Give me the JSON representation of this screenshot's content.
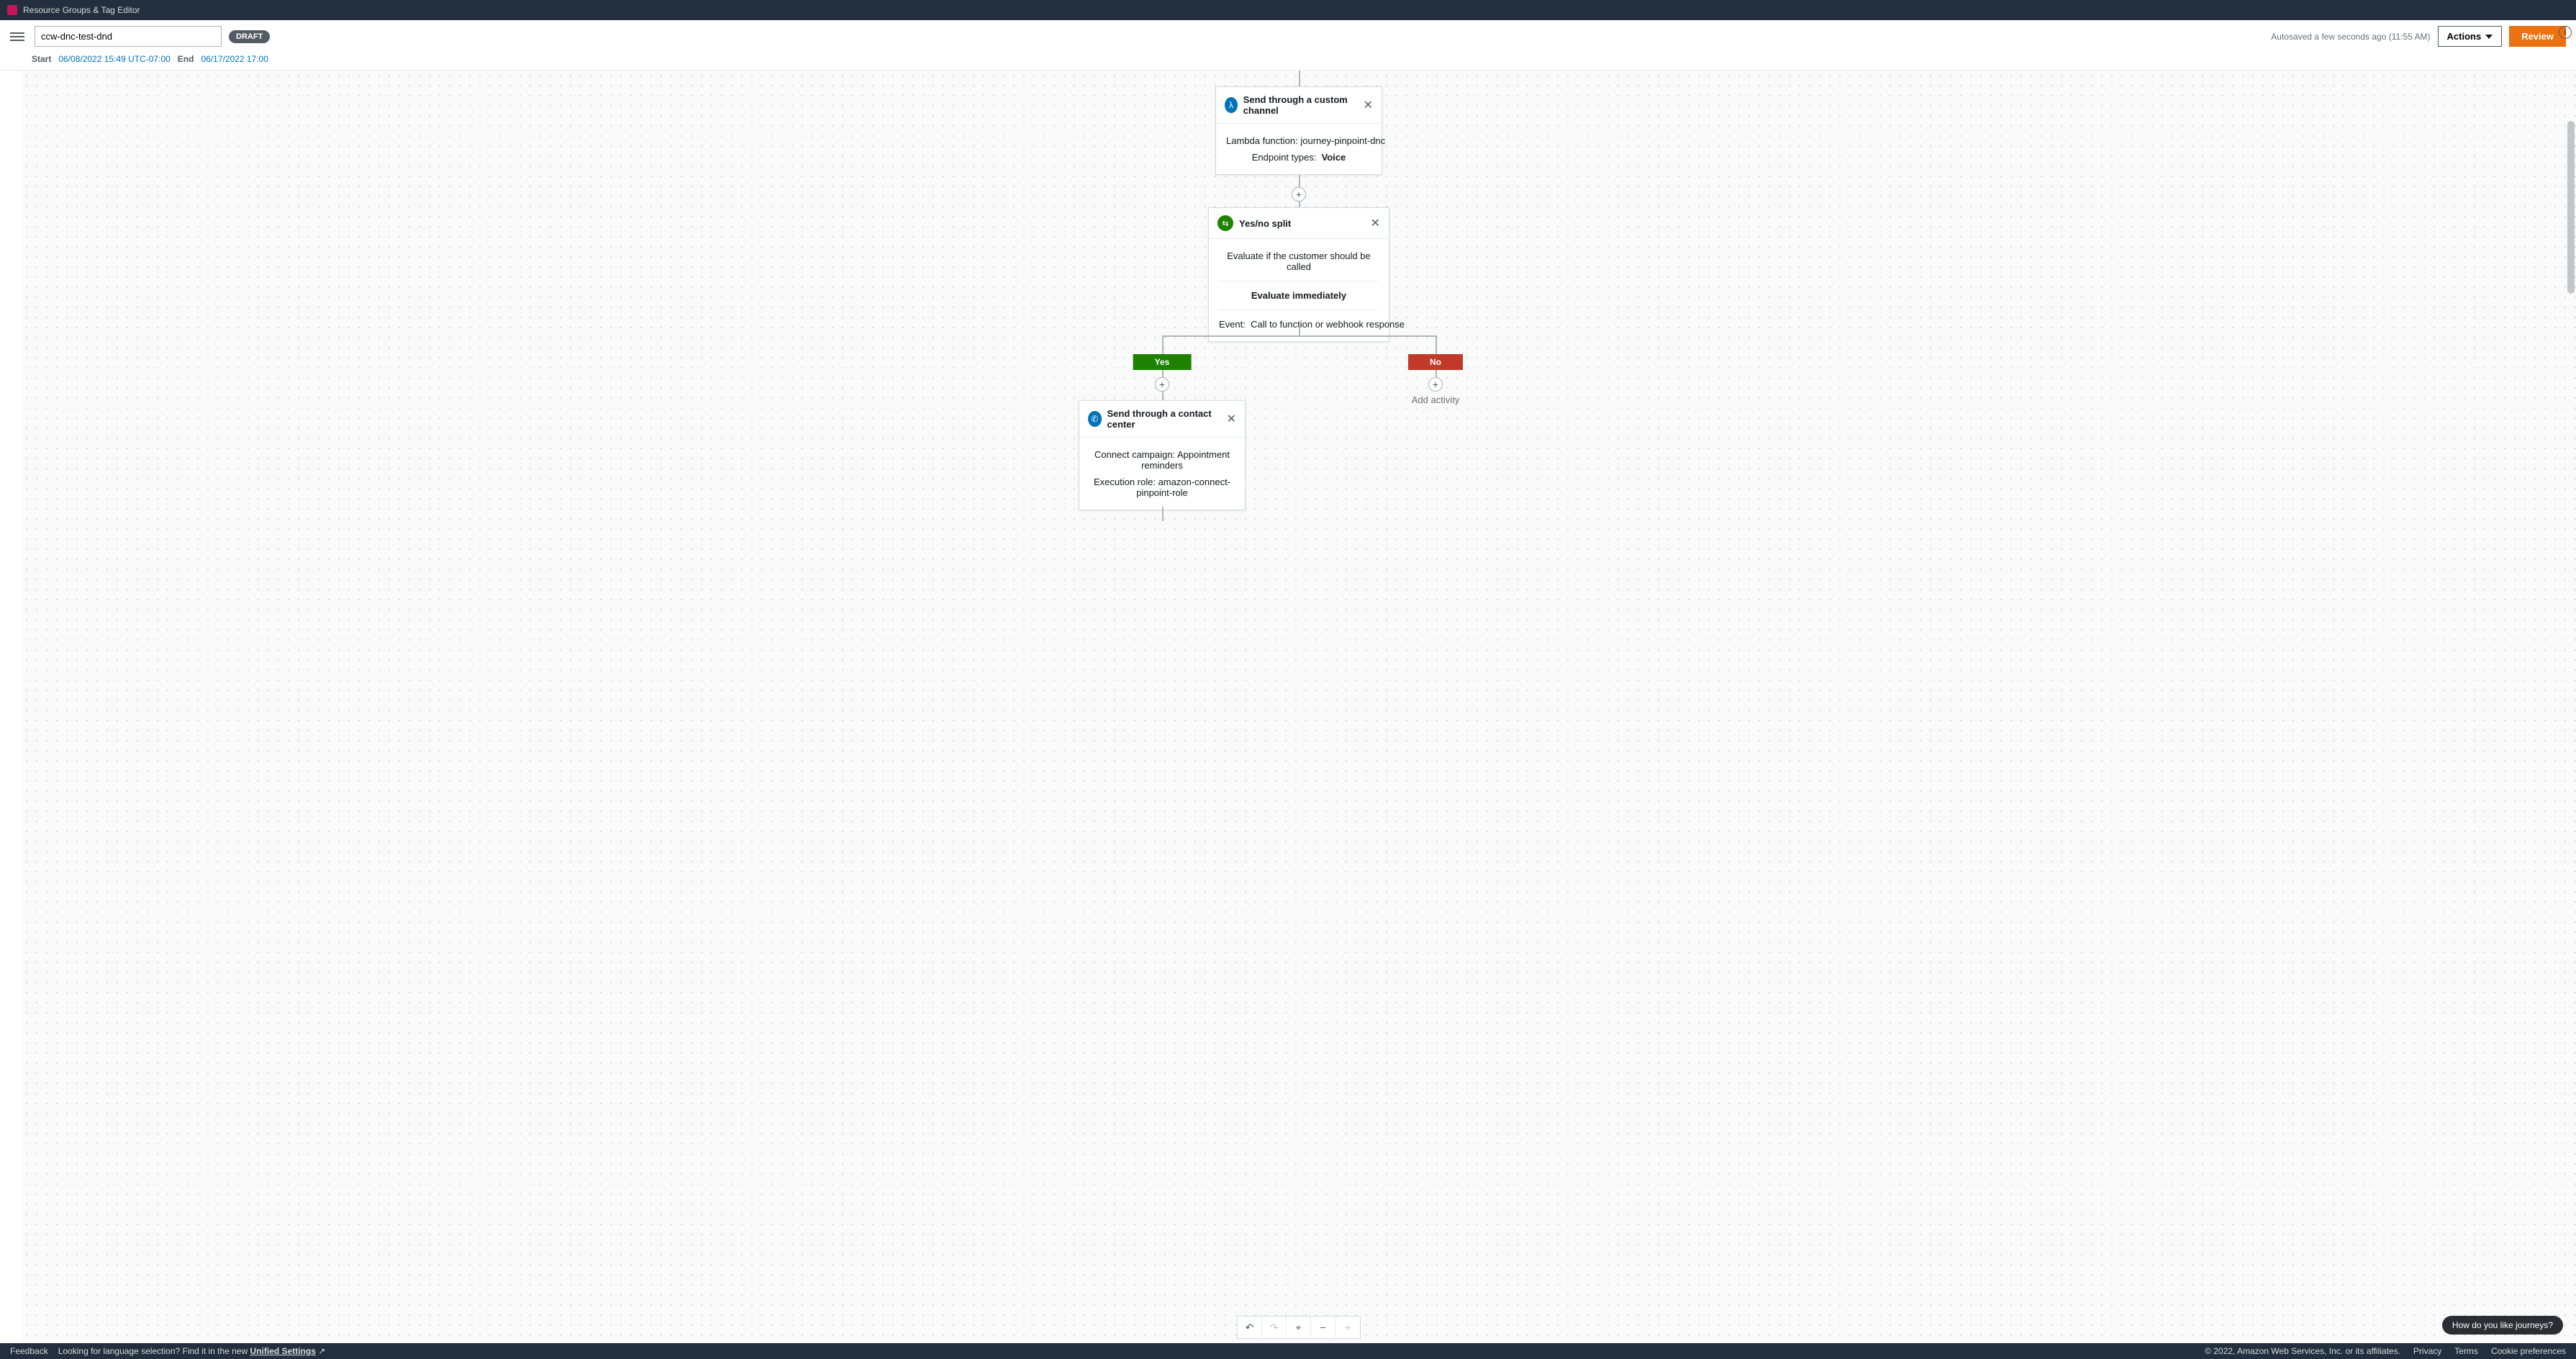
{
  "topbar": {
    "label": "Resource Groups & Tag Editor"
  },
  "header": {
    "journey_name": "ccw-dnc-test-dnd",
    "status_badge": "DRAFT",
    "autosave": "Autosaved a few seconds ago (11:55 AM)",
    "actions_label": "Actions",
    "review_label": "Review",
    "start_label": "Start",
    "start_value": "06/08/2022 15:49 UTC-07:00",
    "end_label": "End",
    "end_value": "06/17/2022 17:00"
  },
  "nodes": {
    "custom_channel": {
      "title": "Send through a custom channel",
      "lambda_label": "Lambda function:",
      "lambda_value": "journey-pinpoint-dnc",
      "endpoint_label": "Endpoint types:",
      "endpoint_value": "Voice"
    },
    "split": {
      "title": "Yes/no split",
      "desc": "Evaluate if the customer should be called",
      "timing": "Evaluate immediately",
      "event_label": "Event:",
      "event_value": "Call to function or webhook response"
    },
    "yes_label": "Yes",
    "no_label": "No",
    "add_activity": "Add activity",
    "contact_center": {
      "title": "Send through a contact center",
      "campaign_label": "Connect campaign:",
      "campaign_value": "Appointment reminders",
      "role_label": "Execution role:",
      "role_value": "amazon-connect-pinpoint-role"
    }
  },
  "feedback_pill": "How do you like journeys?",
  "footer": {
    "feedback": "Feedback",
    "lang_prompt": "Looking for language selection? Find it in the new ",
    "unified": "Unified Settings",
    "copyright": "© 2022, Amazon Web Services, Inc. or its affiliates.",
    "privacy": "Privacy",
    "terms": "Terms",
    "cookies": "Cookie preferences"
  }
}
